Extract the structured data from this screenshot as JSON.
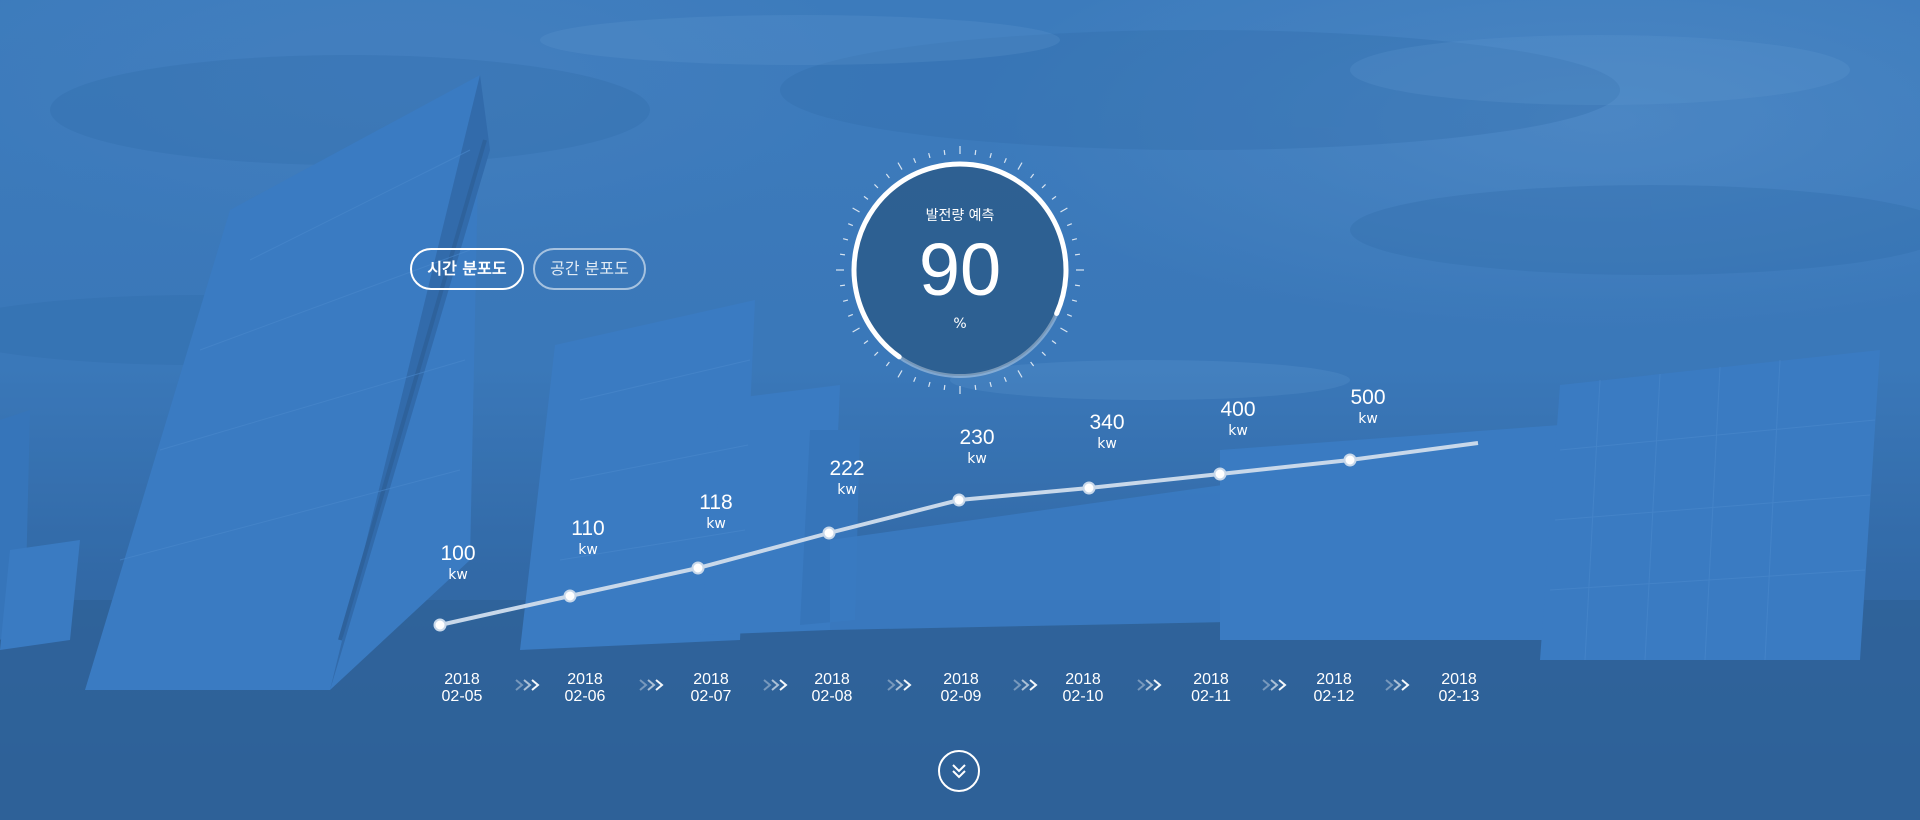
{
  "tabs": {
    "time": "시간 분포도",
    "space": "공간 분포도"
  },
  "gauge": {
    "title": "발전량 예측",
    "value": "90",
    "unit": "%",
    "percent": 90
  },
  "points": [
    {
      "value": "100",
      "unit": "kw",
      "date_year": "2018",
      "date_md": "02-05"
    },
    {
      "value": "110",
      "unit": "kw",
      "date_year": "2018",
      "date_md": "02-06"
    },
    {
      "value": "118",
      "unit": "kw",
      "date_year": "2018",
      "date_md": "02-07"
    },
    {
      "value": "222",
      "unit": "kw",
      "date_year": "2018",
      "date_md": "02-08"
    },
    {
      "value": "230",
      "unit": "kw",
      "date_year": "2018",
      "date_md": "02-09"
    },
    {
      "value": "340",
      "unit": "kw",
      "date_year": "2018",
      "date_md": "02-10"
    },
    {
      "value": "400",
      "unit": "kw",
      "date_year": "2018",
      "date_md": "02-11"
    },
    {
      "value": "500",
      "unit": "kw",
      "date_year": "2018",
      "date_md": "02-12"
    },
    {
      "value": "",
      "unit": "",
      "date_year": "2018",
      "date_md": "02-13"
    }
  ],
  "icons": {
    "scroll": "chevron-double-down-icon",
    "date_separator": "triple-chevron-right-icon"
  },
  "colors": {
    "background": "#3a78b8",
    "line": "#c8d8ea",
    "gauge_fill": "#2c5d8e"
  }
}
